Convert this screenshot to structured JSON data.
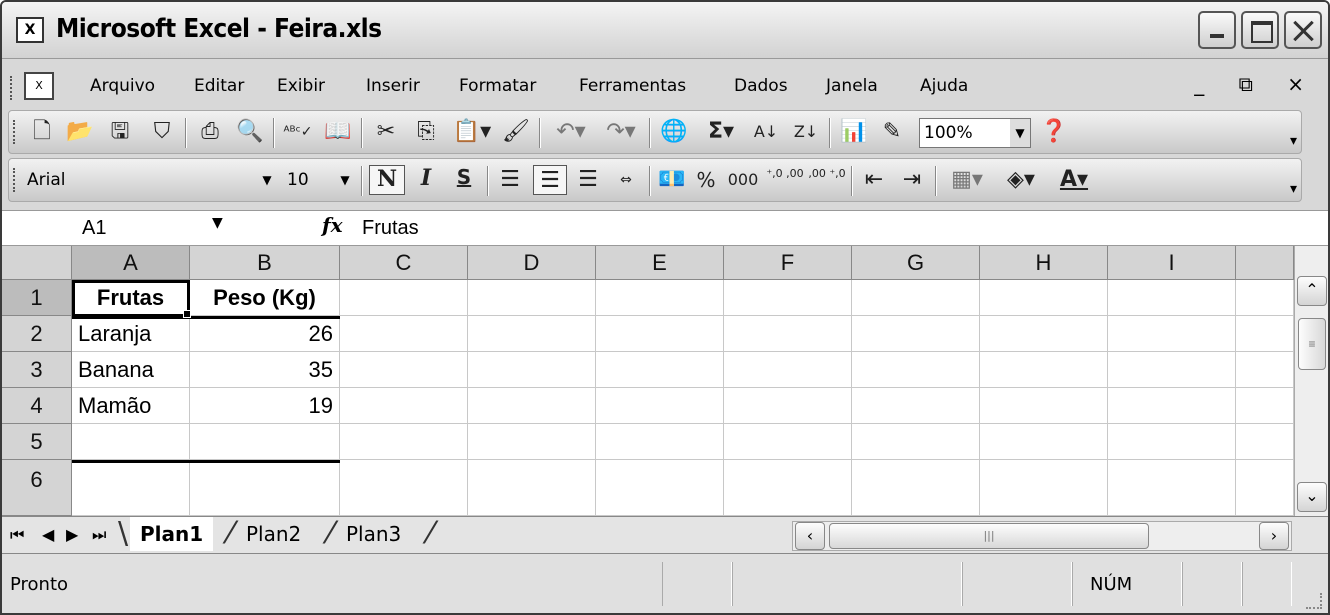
{
  "window": {
    "app_icon": "X",
    "title": "Microsoft Excel - Feira.xls",
    "controls": [
      "minimize-icon",
      "maximize-icon",
      "close-icon"
    ]
  },
  "menubar": {
    "doc_icon": "X",
    "items": [
      {
        "label": "Arquivo"
      },
      {
        "label": "Editar"
      },
      {
        "label": "Exibir"
      },
      {
        "label": "Inserir"
      },
      {
        "label": "Formatar"
      },
      {
        "label": "Ferramentas"
      },
      {
        "label": "Dados"
      },
      {
        "label": "Janela"
      },
      {
        "label": "Ajuda"
      }
    ],
    "mdi_controls": "_ ⧉ ×"
  },
  "standard_toolbar": {
    "icons": [
      "new-icon",
      "open-icon",
      "save-icon",
      "permission-icon",
      "print-icon",
      "print-preview-icon",
      "spelling-icon",
      "research-icon",
      "cut-icon",
      "copy-icon",
      "paste-icon",
      "format-painter-icon",
      "undo-icon",
      "redo-icon",
      "hyperlink-icon",
      "autosum-icon",
      "sort-ascending-icon",
      "sort-descending-icon",
      "chart-wizard-icon",
      "drawing-icon",
      "help-icon"
    ],
    "autosum_glyph": "Σ",
    "zoom": "100%"
  },
  "formatting_toolbar": {
    "font": "Arial",
    "size": "10",
    "bold": "N",
    "italic": "I",
    "underline": "S",
    "percent": "%",
    "thousands": "000",
    "inc_decimal": "⁺,0 ,00",
    "dec_decimal": ",00 ⁺,0",
    "font_color_glyph": "A"
  },
  "formula_bar": {
    "name_box": "A1",
    "fx": "fx",
    "content": "Frutas"
  },
  "sheet": {
    "columns": [
      "A",
      "B",
      "C",
      "D",
      "E",
      "F",
      "G",
      "H",
      "I"
    ],
    "rows": [
      "1",
      "2",
      "3",
      "4",
      "5",
      "6"
    ],
    "cells": {
      "A1": "Frutas",
      "B1": "Peso (Kg)",
      "A2": "Laranja",
      "B2": "26",
      "A3": "Banana",
      "B3": "35",
      "A4": "Mamão",
      "B4": "19"
    }
  },
  "tabs": {
    "sheets": [
      "Plan1",
      "Plan2",
      "Plan3"
    ],
    "active": "Plan1"
  },
  "statusbar": {
    "status": "Pronto",
    "numlock": "NÚM"
  }
}
